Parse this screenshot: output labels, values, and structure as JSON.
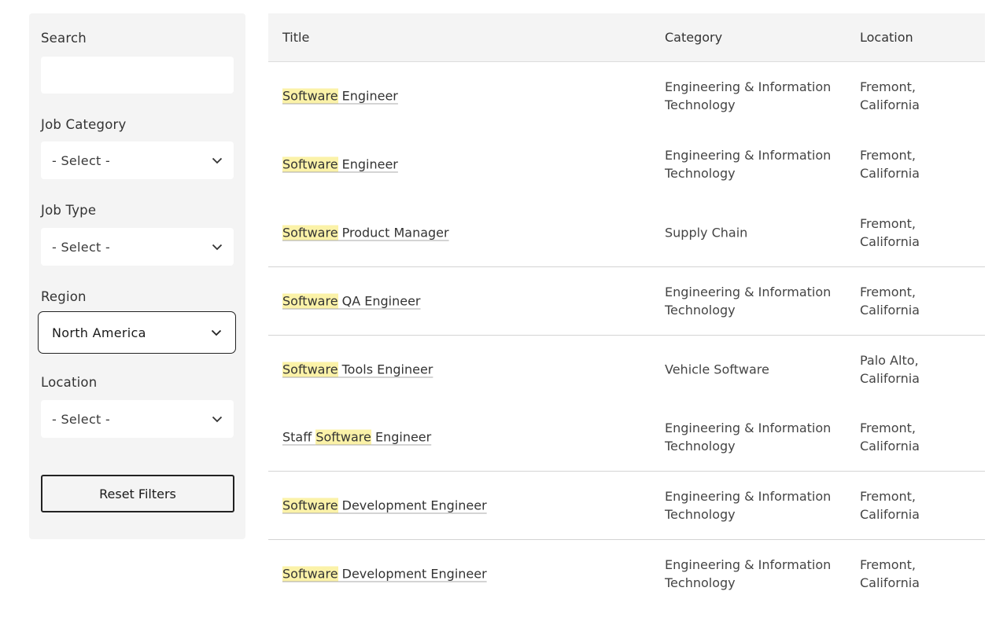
{
  "filters": {
    "search_label": "Search",
    "search_value": "",
    "job_category_label": "Job Category",
    "job_category_value": "- Select -",
    "job_type_label": "Job Type",
    "job_type_value": "- Select -",
    "region_label": "Region",
    "region_value": "North America",
    "location_label": "Location",
    "location_value": "- Select -",
    "reset_label": "Reset Filters"
  },
  "table": {
    "headers": {
      "title": "Title",
      "category": "Category",
      "location": "Location"
    },
    "rows": [
      {
        "title_pre": "",
        "title_hl": "Software",
        "title_post": " Engineer",
        "category": "Engineering & Information Technology",
        "location": "Fremont, California"
      },
      {
        "title_pre": "",
        "title_hl": "Software",
        "title_post": " Engineer",
        "category": "Engineering & Information Technology",
        "location": "Fremont, California"
      },
      {
        "title_pre": "",
        "title_hl": "Software",
        "title_post": " Product Manager",
        "category": "Supply Chain",
        "location": "Fremont, California"
      },
      {
        "title_pre": "",
        "title_hl": "Software",
        "title_post": " QA Engineer",
        "category": "Engineering & Information Technology",
        "location": "Fremont, California"
      },
      {
        "title_pre": "",
        "title_hl": "Software",
        "title_post": " Tools Engineer",
        "category": "Vehicle Software",
        "location": "Palo Alto, California"
      },
      {
        "title_pre": "Staff ",
        "title_hl": "Software",
        "title_post": " Engineer",
        "category": "Engineering & Information Technology",
        "location": "Fremont, California"
      },
      {
        "title_pre": "",
        "title_hl": "Software",
        "title_post": " Development Engineer",
        "category": "Engineering & Information Technology",
        "location": "Fremont, California"
      },
      {
        "title_pre": "",
        "title_hl": "Software",
        "title_post": " Development Engineer",
        "category": "Engineering & Information Technology",
        "location": "Fremont, California"
      }
    ]
  },
  "colors": {
    "highlight": "#fbf2a8",
    "sidebar_bg": "#f4f4f4",
    "header_bg": "#f4f4f4"
  },
  "icons": {
    "select_chevron": "chevron-down-icon"
  }
}
